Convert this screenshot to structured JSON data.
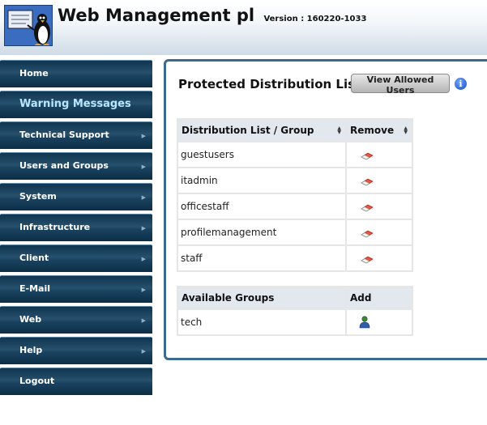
{
  "header": {
    "title": "Web Management pl",
    "version": "Version : 160220-1033"
  },
  "nav": {
    "items": [
      {
        "label": "Home",
        "has_submenu": false,
        "active": false
      },
      {
        "label": "Warning Messages",
        "has_submenu": false,
        "active": true
      },
      {
        "label": "Technical Support",
        "has_submenu": true,
        "active": false
      },
      {
        "label": "Users and Groups",
        "has_submenu": true,
        "active": false
      },
      {
        "label": "System",
        "has_submenu": true,
        "active": false
      },
      {
        "label": "Infrastructure",
        "has_submenu": true,
        "active": false
      },
      {
        "label": "Client",
        "has_submenu": true,
        "active": false
      },
      {
        "label": "E-Mail",
        "has_submenu": true,
        "active": false
      },
      {
        "label": "Web",
        "has_submenu": true,
        "active": false
      },
      {
        "label": "Help",
        "has_submenu": true,
        "active": false
      },
      {
        "label": "Logout",
        "has_submenu": false,
        "active": false
      }
    ]
  },
  "main": {
    "title": "Protected Distribution Lists",
    "view_users_button": "View Allowed Users",
    "protected_table": {
      "columns": [
        "Distribution List / Group",
        "Remove"
      ],
      "rows": [
        "guestusers",
        "itadmin",
        "officestaff",
        "profilemanagement",
        "staff"
      ]
    },
    "available_table": {
      "columns": [
        "Available Groups",
        "Add"
      ],
      "rows": [
        "tech"
      ]
    }
  },
  "icons": {
    "logo": "penguin-logo-icon",
    "info": "info-icon",
    "remove": "eraser-icon",
    "add": "add-user-icon",
    "sort": "sort-arrows-icon",
    "submenu": "submenu-arrow-icon"
  },
  "colors": {
    "nav_background": "#1a4360",
    "panel_border": "#3c6a8c",
    "active_nav_text": "#b9e6ff"
  }
}
